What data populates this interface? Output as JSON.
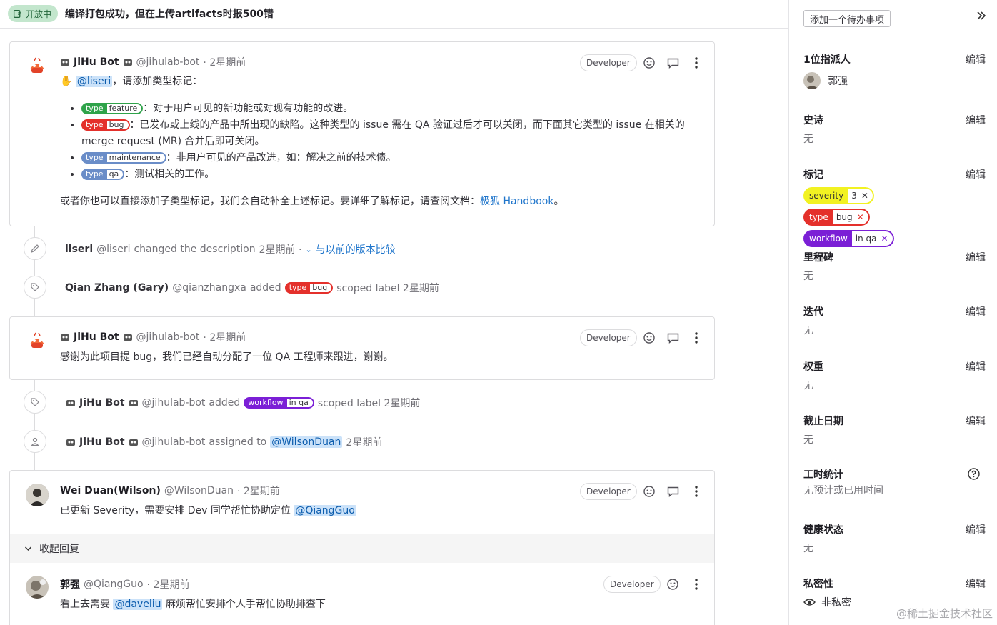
{
  "issue": {
    "status": "开放中",
    "title": "编译打包成功，但在上传artifacts时报500错"
  },
  "colors": {
    "type": "#e4302b",
    "feature": "#2fa34a",
    "maintenance": "#6a8dc8",
    "qa": "#6a8dc8",
    "workflow": "#7b1fd6",
    "severity": "#f2f222"
  },
  "notes": [
    {
      "author": "JiHu Bot",
      "handle": "@jihulab-bot",
      "time": "· 2星期前",
      "role": "Developer",
      "greeting_mention": "@liseri",
      "greeting_text": "，请添加类型标记：",
      "items": [
        {
          "label_key": "type",
          "label_value": "feature",
          "text": "：对于用户可见的新功能或对现有功能的改进。"
        },
        {
          "label_key": "type",
          "label_value": "bug",
          "text": "：已发布或上线的产品中所出现的缺陷。这种类型的 issue 需在 QA 验证过后才可以关闭，而下面其它类型的 issue 在相关的",
          "text2": "merge request (MR) 合并后即可关闭。"
        },
        {
          "label_key": "type",
          "label_value": "maintenance",
          "text": "：非用户可见的产品改进，如：解决之前的技术债。"
        },
        {
          "label_key": "type",
          "label_value": "qa",
          "text": "：测试相关的工作。"
        }
      ],
      "footer_text": "或者你也可以直接添加子类型标记，我们会自动补全上述标记。要详细了解标记，请查阅文档：",
      "footer_link": "极狐 Handbook",
      "footer_end": "。"
    },
    {
      "author": "JiHu Bot",
      "handle": "@jihulab-bot",
      "time": "· 2星期前",
      "role": "Developer",
      "text": "感谢为此项目提 bug，我们已经自动分配了一位 QA 工程师来跟进，谢谢。"
    },
    {
      "author": "Wei Duan(Wilson)",
      "handle": "@WilsonDuan",
      "time": "· 2星期前",
      "role": "Developer",
      "text": "已更新 Severity，需要安排 Dev 同学帮忙协助定位",
      "mention": "@QiangGuo"
    },
    {
      "author": "郭强",
      "handle": "@QiangGuo",
      "time": "· 2星期前",
      "role": "Developer",
      "text": "看上去需要",
      "mention": "@daveliu",
      "text_after": "麻烦帮忙安排个人手帮忙协助排查下"
    }
  ],
  "system_notes": [
    {
      "author": "liseri",
      "handle": "@liseri",
      "action": "changed the description",
      "time": "2星期前 ·",
      "compare": "与以前的版本比较"
    },
    {
      "author": "Qian Zhang (Gary)",
      "handle": "@qianzhangxa",
      "action": "added",
      "label_key": "type",
      "label_value": "bug",
      "suffix": "scoped label 2星期前"
    },
    {
      "author": "JiHu Bot",
      "handle": "@jihulab-bot",
      "action": "added",
      "label_key": "workflow",
      "label_value": "in qa",
      "suffix": "scoped label 2星期前"
    },
    {
      "author": "JiHu Bot",
      "handle": "@jihulab-bot",
      "action": "assigned to",
      "mention": "@WilsonDuan",
      "suffix": "2星期前"
    }
  ],
  "collapse_replies": "收起回复",
  "sidebar": {
    "todo": "添加一个待办事项",
    "edit": "编辑",
    "assignee": {
      "title": "1位指派人",
      "name": "郭强"
    },
    "epic": {
      "title": "史诗",
      "value": "无"
    },
    "labels": {
      "title": "标记",
      "items": [
        {
          "key": "severity",
          "value": "3"
        },
        {
          "key": "type",
          "value": "bug"
        },
        {
          "key": "workflow",
          "value": "in qa"
        }
      ]
    },
    "milestone": {
      "title": "里程碑",
      "value": "无"
    },
    "iteration": {
      "title": "迭代",
      "value": "无"
    },
    "weight": {
      "title": "权重",
      "value": "无"
    },
    "due_date": {
      "title": "截止日期",
      "value": "无"
    },
    "time_tracking": {
      "title": "工时统计",
      "value": "无预计或已用时间"
    },
    "health": {
      "title": "健康状态",
      "value": "无"
    },
    "confidentiality": {
      "title": "私密性",
      "value": "非私密"
    }
  },
  "watermark": "@稀土掘金技术社区"
}
